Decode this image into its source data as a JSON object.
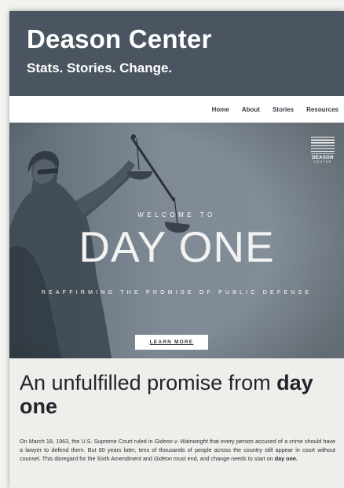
{
  "header": {
    "title": "Deason Center",
    "tagline": "Stats. Stories. Change."
  },
  "nav": {
    "items": [
      "Home",
      "About",
      "Stories",
      "Resources"
    ]
  },
  "hero": {
    "logo_name": "DEASON",
    "logo_sub": "CENTER",
    "eyebrow": "WELCOME TO",
    "title": "DAY ONE",
    "subtitle": "REAFFIRMING THE PROMISE OF PUBLIC DEFENSE",
    "cta_label": "LEARN MORE",
    "logo_icon": "stripes-logo-icon",
    "image": "lady-justice-statue"
  },
  "intro": {
    "heading_part1": "An unfulfilled promise from ",
    "heading_bold": "day one",
    "body_1": "On March 18, 1963, the U.S. Supreme Court ruled in ",
    "body_case": "Gideon v. Wainwright",
    "body_2": " that every person accused of a crime should have a lawyer to defend them. But 60 years later, tens of thousands of people across the country still appear in court without counsel. This disregard for the Sixth Amendment and ",
    "body_case2": "Gideon",
    "body_3": " must end, and change needs to start on ",
    "body_bold": "day one.",
    "body_4": ""
  },
  "colors": {
    "header_bg": "#4a5561",
    "hero_bg": "#7d8893",
    "content_bg": "#eeeeea"
  }
}
